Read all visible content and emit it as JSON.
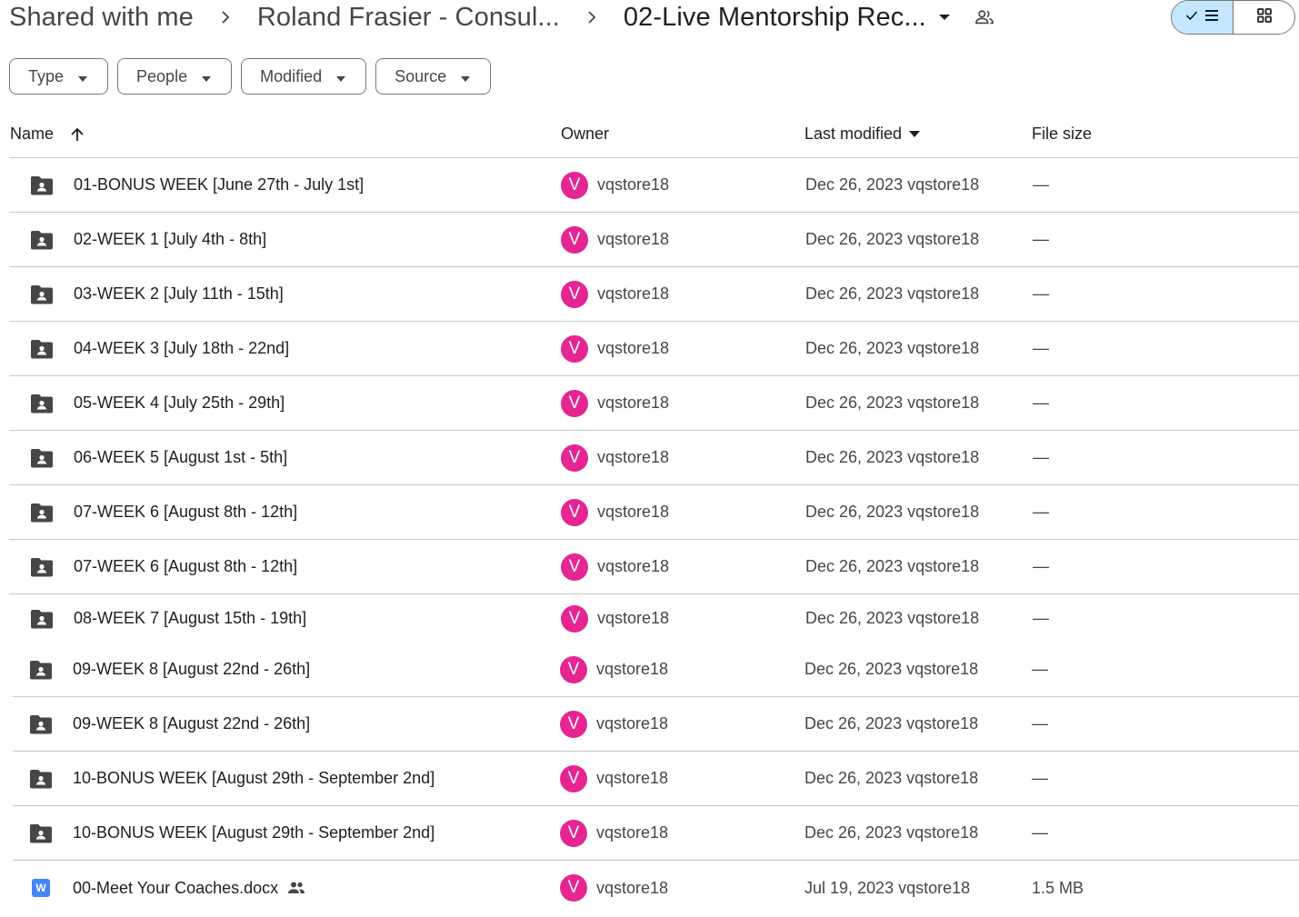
{
  "breadcrumb": {
    "items": [
      "Shared with me",
      "Roland Frasier - Consul...",
      "02-Live Mentorship Rec..."
    ]
  },
  "filters": [
    "Type",
    "People",
    "Modified",
    "Source"
  ],
  "columns": {
    "name": "Name",
    "owner": "Owner",
    "modified": "Last modified",
    "size": "File size"
  },
  "colors": {
    "avatar": "#e52592",
    "toggle_active": "#c2e7ff",
    "word": "#4285f4"
  },
  "rows": [
    {
      "icon": "shared-folder-icon",
      "name": "01-BONUS WEEK [June 27th - July 1st]",
      "owner_initial": "V",
      "owner": "vqstore18",
      "modified": "Dec 26, 2023 vqstore18",
      "size": "—"
    },
    {
      "icon": "shared-folder-icon",
      "name": "02-WEEK 1 [July 4th - 8th]",
      "owner_initial": "V",
      "owner": "vqstore18",
      "modified": "Dec 26, 2023 vqstore18",
      "size": "—"
    },
    {
      "icon": "shared-folder-icon",
      "name": "03-WEEK 2 [July 11th - 15th]",
      "owner_initial": "V",
      "owner": "vqstore18",
      "modified": "Dec 26, 2023 vqstore18",
      "size": "—"
    },
    {
      "icon": "shared-folder-icon",
      "name": "04-WEEK 3 [July 18th - 22nd]",
      "owner_initial": "V",
      "owner": "vqstore18",
      "modified": "Dec 26, 2023 vqstore18",
      "size": "—"
    },
    {
      "icon": "shared-folder-icon",
      "name": "05-WEEK 4 [July 25th - 29th]",
      "owner_initial": "V",
      "owner": "vqstore18",
      "modified": "Dec 26, 2023 vqstore18",
      "size": "—"
    },
    {
      "icon": "shared-folder-icon",
      "name": "06-WEEK 5 [August 1st - 5th]",
      "owner_initial": "V",
      "owner": "vqstore18",
      "modified": "Dec 26, 2023 vqstore18",
      "size": "—"
    },
    {
      "icon": "shared-folder-icon",
      "name": "07-WEEK 6 [August 8th - 12th]",
      "owner_initial": "V",
      "owner": "vqstore18",
      "modified": "Dec 26, 2023 vqstore18",
      "size": "—"
    },
    {
      "icon": "shared-folder-icon",
      "name": "07-WEEK 6 [August 8th - 12th]",
      "owner_initial": "V",
      "owner": "vqstore18",
      "modified": "Dec 26, 2023 vqstore18",
      "size": "—"
    },
    {
      "icon": "shared-folder-icon",
      "name": "08-WEEK 7 [August 15th - 19th]",
      "owner_initial": "V",
      "owner": "vqstore18",
      "modified": "Dec 26, 2023 vqstore18",
      "size": "—"
    },
    {
      "icon": "shared-folder-icon",
      "name": "09-WEEK 8 [August 22nd - 26th]",
      "owner_initial": "V",
      "owner": "vqstore18",
      "modified": "Dec 26, 2023 vqstore18",
      "size": "—"
    },
    {
      "icon": "shared-folder-icon",
      "name": "09-WEEK 8 [August 22nd - 26th]",
      "owner_initial": "V",
      "owner": "vqstore18",
      "modified": "Dec 26, 2023 vqstore18",
      "size": "—"
    },
    {
      "icon": "shared-folder-icon",
      "name": "10-BONUS WEEK [August 29th - September 2nd]",
      "owner_initial": "V",
      "owner": "vqstore18",
      "modified": "Dec 26, 2023 vqstore18",
      "size": "—"
    },
    {
      "icon": "shared-folder-icon",
      "name": "10-BONUS WEEK [August 29th - September 2nd]",
      "owner_initial": "V",
      "owner": "vqstore18",
      "modified": "Dec 26, 2023 vqstore18",
      "size": "—"
    },
    {
      "icon": "word-doc-icon",
      "file_badge": "W",
      "name": "00-Meet Your Coaches.docx",
      "shared": true,
      "owner_initial": "V",
      "owner": "vqstore18",
      "modified": "Jul 19, 2023 vqstore18",
      "size": "1.5 MB"
    }
  ]
}
